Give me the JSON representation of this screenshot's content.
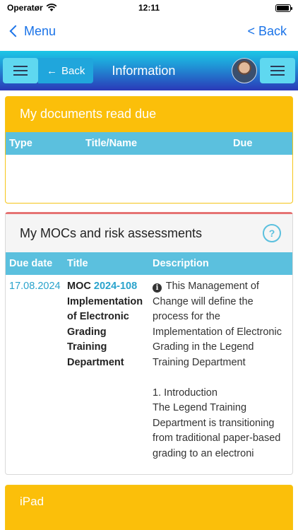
{
  "status": {
    "carrier": "Operatør",
    "time": "12:11",
    "battery_level": 0.95
  },
  "ios_nav": {
    "back_label": "Menu",
    "right_label": "< Back"
  },
  "header": {
    "back_label": "Back",
    "title": "Information"
  },
  "documents_panel": {
    "title": "My documents read due",
    "columns": [
      "Type",
      "Title/Name",
      "Due"
    ],
    "rows": []
  },
  "moc_panel": {
    "title": "My MOCs and risk assessments",
    "help_glyph": "?",
    "columns": [
      "Due date",
      "Title",
      "Description"
    ],
    "rows": [
      {
        "due_date": "17.08.2024",
        "title_prefix": "MOC",
        "moc_number": "2024-108",
        "title_lines": [
          "Implementation",
          "of Electronic",
          "Grading",
          "Training",
          "Department"
        ],
        "description_lines_1": [
          "This Management of",
          "Change will define the",
          "process for the",
          "Implementation of Electronic",
          "Grading in the Legend",
          "Training Department"
        ],
        "description_lines_2": [
          "1. Introduction",
          "The Legend Training",
          "Department is transitioning",
          "from traditional paper-based",
          "grading to an electroni"
        ]
      }
    ]
  },
  "ipad_panel": {
    "title": "iPad"
  },
  "colors": {
    "accent_blue": "#1a73e8",
    "warning": "#fbbf0a",
    "info": "#5bc0de",
    "danger_top": "#e57373"
  },
  "icons": [
    "wifi-icon",
    "battery-icon",
    "chevron-left-icon",
    "hamburger-menu-icon",
    "arrow-left-icon",
    "avatar",
    "help-icon",
    "info-icon"
  ]
}
